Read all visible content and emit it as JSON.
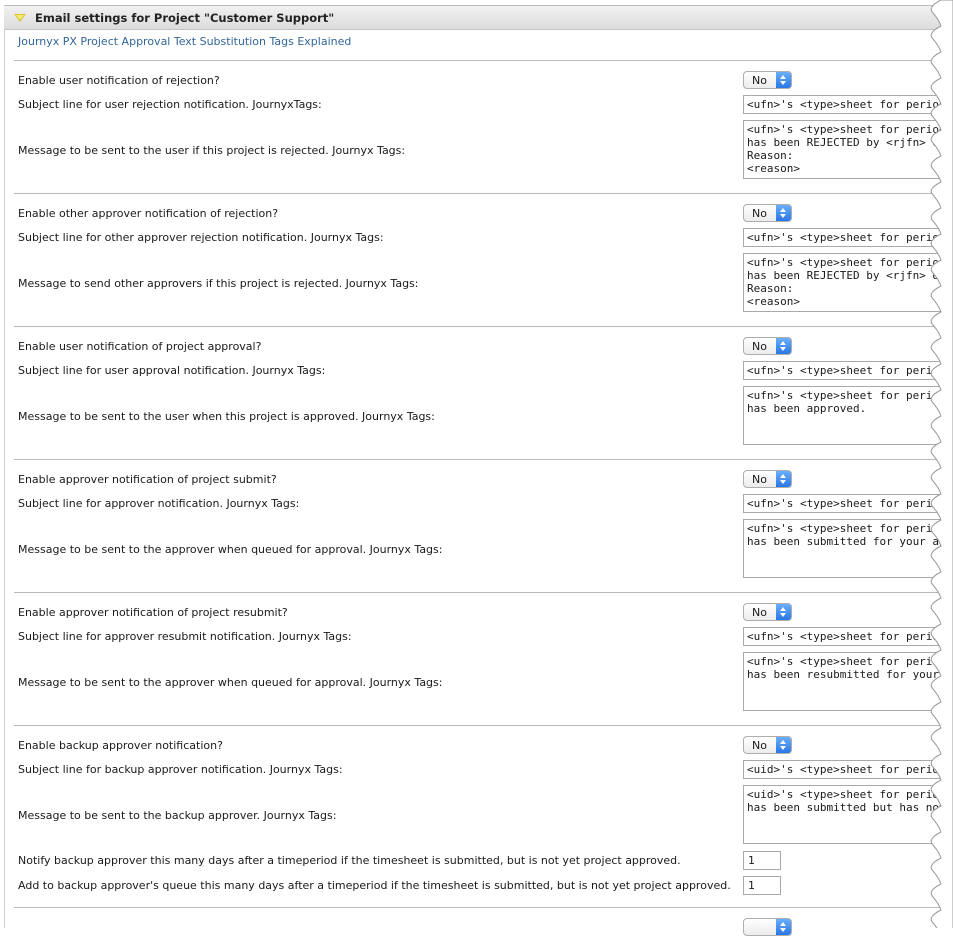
{
  "section": {
    "title": "Email settings for Project \"Customer Support\"",
    "explain_link": "Journyx PX Project Approval Text Substitution Tags Explained"
  },
  "groups": [
    {
      "enable_label": "Enable user notification of rejection?",
      "enable_value": "No",
      "subject_label": "Subject line for user rejection notification. JournyxTags:",
      "subject_value": "<ufn>'s <type>sheet for period <pr",
      "message_label": "Message to be sent to the user if this project is rejected. Journyx Tags:",
      "message_value": "<ufn>'s <type>sheet for period <p\nhas been REJECTED by <rjfn> on <\nReason:\n<reason>"
    },
    {
      "enable_label": "Enable other approver notification of rejection?",
      "enable_value": "No",
      "subject_label": "Subject line for other approver rejection notification. Journyx Tags:",
      "subject_value": "<ufn>'s <type>sheet for period <p",
      "message_label": "Message to send other approvers if this project is rejected. Journyx Tags:",
      "message_value": "<ufn>'s <type>sheet for period <pr\nhas been REJECTED by <rjfn> on <\nReason:\n<reason>"
    },
    {
      "enable_label": "Enable user notification of project approval?",
      "enable_value": "No",
      "subject_label": "Subject line for user approval notification. Journyx Tags:",
      "subject_value": "<ufn>'s <type>sheet for period <p",
      "message_label": "Message to be sent to the user when this project is approved. Journyx Tags:",
      "message_value": "<ufn>'s <type>sheet for period <pr\nhas been approved."
    },
    {
      "enable_label": "Enable approver notification of project submit?",
      "enable_value": "No",
      "subject_label": "Subject line for approver notification. Journyx Tags:",
      "subject_value": "<ufn>'s <type>sheet for period <pr",
      "message_label": "Message to be sent to the approver when queued for approval. Journyx Tags:",
      "message_value": "<ufn>'s <type>sheet for period <p\nhas been submitted for your approva"
    },
    {
      "enable_label": "Enable approver notification of project resubmit?",
      "enable_value": "No",
      "subject_label": "Subject line for approver resubmit notification. Journyx Tags:",
      "subject_value": "<ufn>'s <type>sheet for period <pr",
      "message_label": "Message to be sent to the approver when queued for approval. Journyx Tags:",
      "message_value": "<ufn>'s <type>sheet for period <p\nhas been resubmitted for your appr"
    },
    {
      "enable_label": "Enable backup approver notification?",
      "enable_value": "No",
      "subject_label": "Subject line for backup approver notification. Journyx Tags:",
      "subject_value": "<uid>'s <type>sheet for period <p",
      "message_label": "Message to be sent to the backup approver. Journyx Tags:",
      "message_value": "<uid>'s <type>sheet for period <pr\nhas been submitted but has not be"
    }
  ],
  "backup": {
    "notify_label": "Notify backup approver this many days after a timeperiod if the timesheet is submitted, but is not yet project approved.",
    "notify_value": "1",
    "queue_label": "Add to backup approver's queue this many days after a timeperiod if the timesheet is submitted, but is not yet project approved.",
    "queue_value": "1"
  }
}
